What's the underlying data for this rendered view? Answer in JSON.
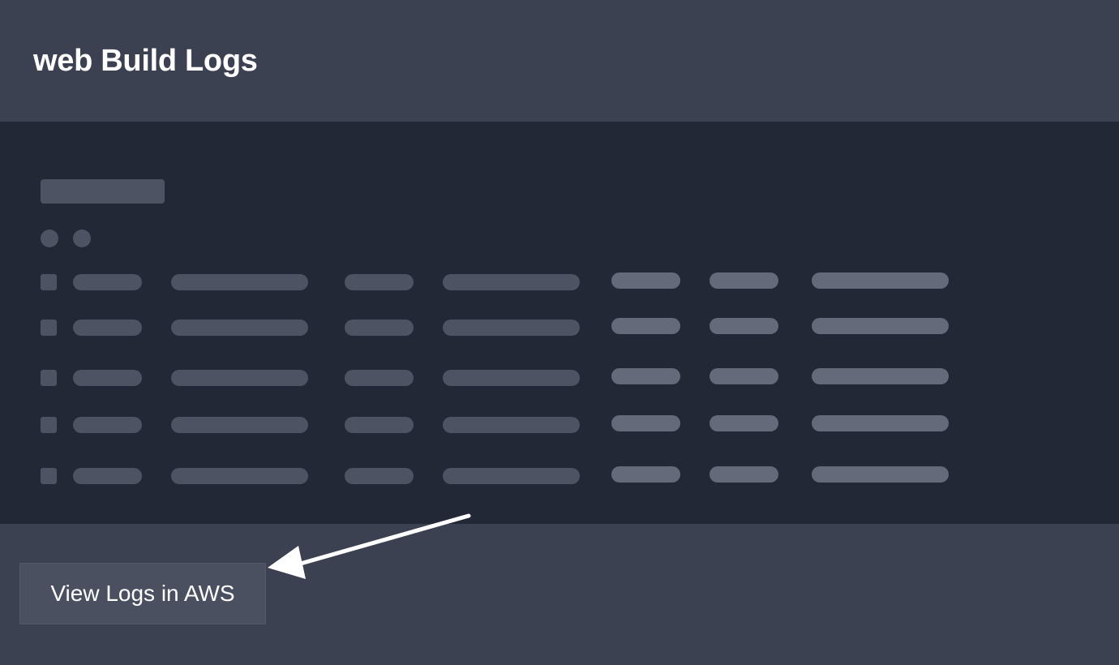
{
  "page": {
    "title": "web Build Logs"
  },
  "log_panel": {
    "state": "loading",
    "skeleton_rows": 5,
    "skeleton_columns": 7
  },
  "footer": {
    "view_logs_button_label": "View Logs in AWS"
  },
  "annotation": {
    "type": "arrow",
    "points_to": "view-logs-in-aws-button"
  },
  "colors": {
    "header_bg": "#3b4150",
    "panel_bg": "#232836",
    "skeleton_dark": "#4d5363",
    "skeleton_light": "#646a7a",
    "button_bg": "#4a5060",
    "text": "#ffffff"
  }
}
